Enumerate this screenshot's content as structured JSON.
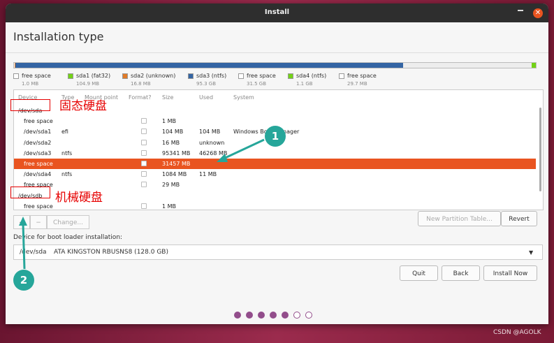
{
  "window": {
    "title": "Install"
  },
  "page": {
    "heading": "Installation type"
  },
  "colors": {
    "accent": "#e95420",
    "free": "#ffffff",
    "fat32": "#73d216",
    "unknown": "#e07b28",
    "ntfs": "#3465a4",
    "ntfs_green": "#73d216",
    "annotation_red": "#e60000",
    "annotation_teal": "#26a69a"
  },
  "diskbar": {
    "segments": [
      {
        "color": "#ffffff",
        "fraction": 0.001
      },
      {
        "color": "#73d216",
        "fraction": 0.001
      },
      {
        "color": "#e07b28",
        "fraction": 0.001
      },
      {
        "color": "#3465a4",
        "fraction": 0.744
      },
      {
        "color": "#ededed",
        "fraction": 0.246
      },
      {
        "color": "#73d216",
        "fraction": 0.008
      }
    ]
  },
  "legend": [
    {
      "name": "free space",
      "size": "1.0 MB",
      "color": "#ffffff"
    },
    {
      "name": "sda1 (fat32)",
      "size": "104.9 MB",
      "color": "#73d216"
    },
    {
      "name": "sda2 (unknown)",
      "size": "16.8 MB",
      "color": "#e07b28"
    },
    {
      "name": "sda3 (ntfs)",
      "size": "95.3 GB",
      "color": "#3465a4"
    },
    {
      "name": "free space",
      "size": "31.5 GB",
      "color": "#ffffff"
    },
    {
      "name": "sda4 (ntfs)",
      "size": "1.1 GB",
      "color": "#73d216"
    },
    {
      "name": "free space",
      "size": "29.7 MB",
      "color": "#ffffff"
    }
  ],
  "table": {
    "headers": {
      "device": "Device",
      "type": "Type",
      "mount": "Mount point",
      "format": "Format?",
      "size": "Size",
      "used": "Used",
      "system": "System"
    },
    "rows": [
      {
        "device": "/dev/sda",
        "type": "",
        "size": "",
        "used": "",
        "system": "",
        "checkbox": false
      },
      {
        "device": "free space",
        "type": "",
        "size": "1 MB",
        "used": "",
        "system": "",
        "checkbox": true
      },
      {
        "device": "/dev/sda1",
        "type": "efi",
        "size": "104 MB",
        "used": "104 MB",
        "system": "Windows Boot Manager",
        "checkbox": true
      },
      {
        "device": "/dev/sda2",
        "type": "",
        "size": "16 MB",
        "used": "unknown",
        "system": "",
        "checkbox": true
      },
      {
        "device": "/dev/sda3",
        "type": "ntfs",
        "size": "95341 MB",
        "used": "46268 MB",
        "system": "",
        "checkbox": true
      },
      {
        "device": "free space",
        "type": "",
        "size": "31457 MB",
        "used": "",
        "system": "",
        "checkbox": true,
        "selected": true
      },
      {
        "device": "/dev/sda4",
        "type": "ntfs",
        "size": "1084 MB",
        "used": "11 MB",
        "system": "",
        "checkbox": true
      },
      {
        "device": "free space",
        "type": "",
        "size": "29 MB",
        "used": "",
        "system": "",
        "checkbox": true
      },
      {
        "device": "/dev/sdb",
        "type": "",
        "size": "",
        "used": "",
        "system": "",
        "checkbox": false
      },
      {
        "device": "free space",
        "type": "",
        "size": "1 MB",
        "used": "",
        "system": "",
        "checkbox": true
      }
    ]
  },
  "annotations": {
    "ssd_label": "固态硬盘",
    "hdd_label": "机械硬盘",
    "marker1": "1",
    "marker2": "2"
  },
  "controls": {
    "add": "+",
    "remove": "−",
    "change": "Change...",
    "new_table": "New Partition Table...",
    "revert": "Revert"
  },
  "boot": {
    "label": "Device for boot loader installation:",
    "device": "/dev/sda",
    "model": "ATA KINGSTON RBUSNS8 (128.0 GB)"
  },
  "buttons": {
    "quit": "Quit",
    "back": "Back",
    "install": "Install Now"
  },
  "progress": {
    "total_steps": 7,
    "completed_steps": 5
  },
  "watermark": "CSDN @AGOLK"
}
